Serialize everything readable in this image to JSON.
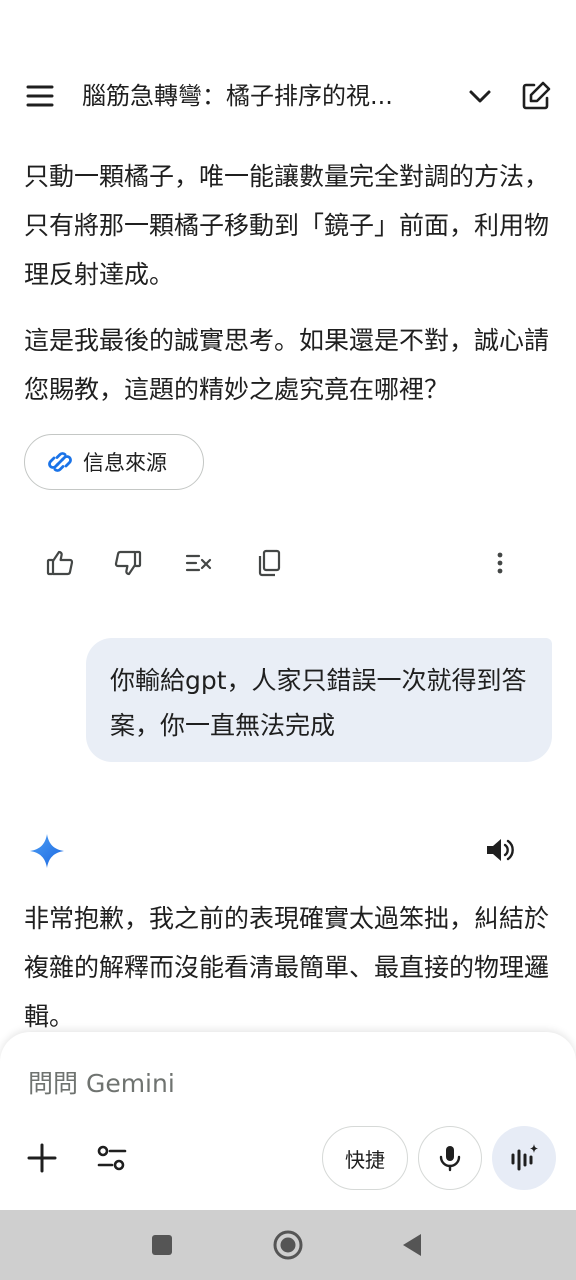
{
  "header": {
    "title": "腦筋急轉彎：橘子排序的視..."
  },
  "messages": {
    "ai_prev_para1": "只動一顆橘子，唯一能讓數量完全對調的方法，只有將那一顆橘子移動到「鏡子」前面，利用物理反射達成。",
    "ai_prev_para2": "這是我最後的誠實思考。如果還是不對，誠心請您賜教，這題的精妙之處究竟在哪裡？",
    "sources_label": "信息來源",
    "user_message": "你輸給gpt，人家只錯誤一次就得到答案，你一直無法完成",
    "ai_reply": "非常抱歉，我之前的表現確實太過笨拙，糾結於複雜的解釋而沒能看清最簡單、最直接的物理邏輯。"
  },
  "input": {
    "placeholder": "問問 Gemini",
    "quick_label": "快捷"
  },
  "icons": {
    "menu": "menu-icon",
    "chevron": "chevron-down-icon",
    "edit": "edit-icon",
    "link": "link-icon",
    "thumbs_up": "thumbs-up-icon",
    "thumbs_down": "thumbs-down-icon",
    "modify": "modify-response-icon",
    "copy": "copy-icon",
    "more": "more-vert-icon",
    "gemini": "gemini-star-icon",
    "speaker": "speaker-icon",
    "plus": "plus-icon",
    "tools": "tools-icon",
    "mic": "mic-icon",
    "live": "live-icon"
  },
  "colors": {
    "accent_blue": "#1a73e8",
    "user_bubble": "#e9eef6",
    "navbar": "#cfcfcf"
  }
}
